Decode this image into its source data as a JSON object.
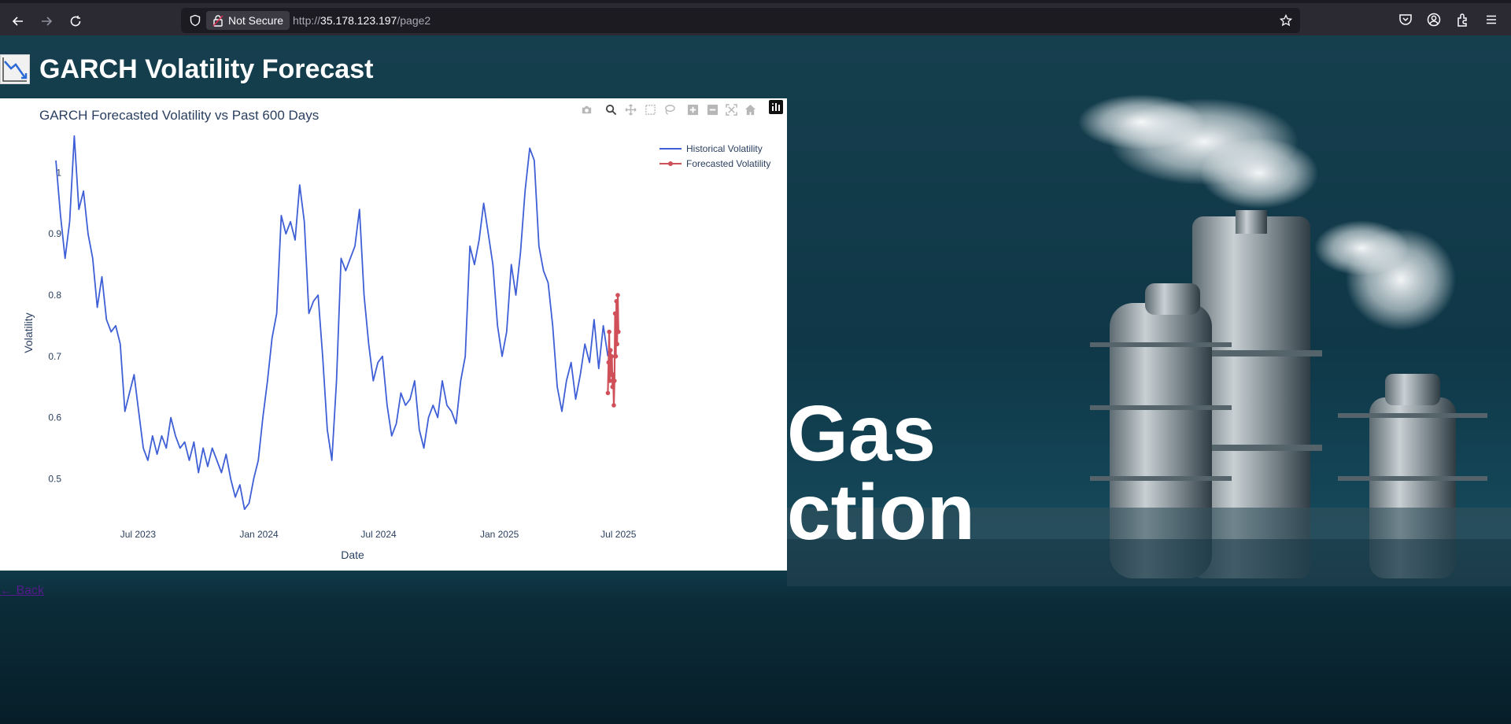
{
  "browser": {
    "security_label": "Not Secure",
    "url_prefix": "http://",
    "url_host": "35.178.123.197",
    "url_path": "/page2"
  },
  "page": {
    "title": "GARCH Volatility Forecast",
    "back_link": "← Back",
    "background_words": [
      "Gas",
      "ction"
    ]
  },
  "modebar": [
    "camera-icon",
    "zoom-icon",
    "pan-icon",
    "box-select-icon",
    "lasso-icon",
    "zoom-in-icon",
    "zoom-out-icon",
    "autoscale-icon",
    "reset-axes-icon",
    "plotly-logo"
  ],
  "colors": {
    "historical": "#3f5fd6",
    "forecast": "#d0505a",
    "text": "#2a3f5f"
  },
  "chart_data": {
    "type": "line",
    "title": "GARCH Forecasted Volatility vs Past 600 Days",
    "xlabel": "Date",
    "ylabel": "Volatility",
    "xlim": [
      "2023-02-20",
      "2025-07-18"
    ],
    "ylim": [
      0.44,
      1.07
    ],
    "x_ticks": [
      {
        "date": "2023-07-01",
        "label": "Jul 2023"
      },
      {
        "date": "2024-01-01",
        "label": "Jan 2024"
      },
      {
        "date": "2024-07-01",
        "label": "Jul 2024"
      },
      {
        "date": "2025-01-01",
        "label": "Jan 2025"
      },
      {
        "date": "2025-07-01",
        "label": "Jul 2025"
      }
    ],
    "y_ticks": [
      0.5,
      0.6,
      0.7,
      0.8,
      0.9,
      1
    ],
    "grid": false,
    "legend_position": "top-right",
    "series": [
      {
        "name": "Historical Volatility",
        "mode": "lines",
        "points": [
          [
            "2023-02-26",
            1.02
          ],
          [
            "2023-03-05",
            0.93
          ],
          [
            "2023-03-12",
            0.86
          ],
          [
            "2023-03-19",
            0.92
          ],
          [
            "2023-03-26",
            1.06
          ],
          [
            "2023-04-02",
            0.94
          ],
          [
            "2023-04-09",
            0.97
          ],
          [
            "2023-04-16",
            0.9
          ],
          [
            "2023-04-23",
            0.86
          ],
          [
            "2023-04-30",
            0.78
          ],
          [
            "2023-05-07",
            0.83
          ],
          [
            "2023-05-14",
            0.76
          ],
          [
            "2023-05-21",
            0.74
          ],
          [
            "2023-05-28",
            0.75
          ],
          [
            "2023-06-04",
            0.72
          ],
          [
            "2023-06-11",
            0.61
          ],
          [
            "2023-06-18",
            0.64
          ],
          [
            "2023-06-25",
            0.67
          ],
          [
            "2023-07-02",
            0.61
          ],
          [
            "2023-07-09",
            0.55
          ],
          [
            "2023-07-16",
            0.53
          ],
          [
            "2023-07-23",
            0.57
          ],
          [
            "2023-07-30",
            0.54
          ],
          [
            "2023-08-06",
            0.57
          ],
          [
            "2023-08-13",
            0.55
          ],
          [
            "2023-08-20",
            0.6
          ],
          [
            "2023-08-27",
            0.57
          ],
          [
            "2023-09-03",
            0.55
          ],
          [
            "2023-09-10",
            0.56
          ],
          [
            "2023-09-17",
            0.53
          ],
          [
            "2023-09-24",
            0.56
          ],
          [
            "2023-10-01",
            0.51
          ],
          [
            "2023-10-08",
            0.55
          ],
          [
            "2023-10-15",
            0.52
          ],
          [
            "2023-10-22",
            0.55
          ],
          [
            "2023-10-29",
            0.53
          ],
          [
            "2023-11-05",
            0.51
          ],
          [
            "2023-11-12",
            0.54
          ],
          [
            "2023-11-19",
            0.5
          ],
          [
            "2023-11-26",
            0.47
          ],
          [
            "2023-12-03",
            0.49
          ],
          [
            "2023-12-10",
            0.45
          ],
          [
            "2023-12-17",
            0.46
          ],
          [
            "2023-12-24",
            0.5
          ],
          [
            "2023-12-31",
            0.53
          ],
          [
            "2024-01-07",
            0.6
          ],
          [
            "2024-01-14",
            0.66
          ],
          [
            "2024-01-21",
            0.73
          ],
          [
            "2024-01-28",
            0.77
          ],
          [
            "2024-02-04",
            0.93
          ],
          [
            "2024-02-11",
            0.9
          ],
          [
            "2024-02-18",
            0.92
          ],
          [
            "2024-02-25",
            0.89
          ],
          [
            "2024-03-03",
            0.98
          ],
          [
            "2024-03-10",
            0.92
          ],
          [
            "2024-03-17",
            0.77
          ],
          [
            "2024-03-24",
            0.79
          ],
          [
            "2024-03-31",
            0.8
          ],
          [
            "2024-04-07",
            0.7
          ],
          [
            "2024-04-14",
            0.58
          ],
          [
            "2024-04-21",
            0.53
          ],
          [
            "2024-04-28",
            0.66
          ],
          [
            "2024-05-05",
            0.86
          ],
          [
            "2024-05-12",
            0.84
          ],
          [
            "2024-05-19",
            0.86
          ],
          [
            "2024-05-26",
            0.88
          ],
          [
            "2024-06-02",
            0.94
          ],
          [
            "2024-06-09",
            0.8
          ],
          [
            "2024-06-16",
            0.72
          ],
          [
            "2024-06-23",
            0.66
          ],
          [
            "2024-06-30",
            0.69
          ],
          [
            "2024-07-07",
            0.7
          ],
          [
            "2024-07-14",
            0.62
          ],
          [
            "2024-07-21",
            0.57
          ],
          [
            "2024-07-28",
            0.59
          ],
          [
            "2024-08-04",
            0.64
          ],
          [
            "2024-08-11",
            0.62
          ],
          [
            "2024-08-18",
            0.63
          ],
          [
            "2024-08-25",
            0.66
          ],
          [
            "2024-09-01",
            0.58
          ],
          [
            "2024-09-08",
            0.55
          ],
          [
            "2024-09-15",
            0.6
          ],
          [
            "2024-09-22",
            0.62
          ],
          [
            "2024-09-29",
            0.6
          ],
          [
            "2024-10-06",
            0.66
          ],
          [
            "2024-10-13",
            0.62
          ],
          [
            "2024-10-20",
            0.61
          ],
          [
            "2024-10-27",
            0.59
          ],
          [
            "2024-11-03",
            0.66
          ],
          [
            "2024-11-10",
            0.7
          ],
          [
            "2024-11-17",
            0.88
          ],
          [
            "2024-11-24",
            0.85
          ],
          [
            "2024-12-01",
            0.89
          ],
          [
            "2024-12-08",
            0.95
          ],
          [
            "2024-12-15",
            0.9
          ],
          [
            "2024-12-22",
            0.85
          ],
          [
            "2024-12-29",
            0.75
          ],
          [
            "2025-01-05",
            0.7
          ],
          [
            "2025-01-12",
            0.74
          ],
          [
            "2025-01-19",
            0.85
          ],
          [
            "2025-01-26",
            0.8
          ],
          [
            "2025-02-02",
            0.87
          ],
          [
            "2025-02-09",
            0.97
          ],
          [
            "2025-02-16",
            1.04
          ],
          [
            "2025-02-23",
            1.02
          ],
          [
            "2025-03-02",
            0.88
          ],
          [
            "2025-03-09",
            0.84
          ],
          [
            "2025-03-16",
            0.82
          ],
          [
            "2025-03-23",
            0.75
          ],
          [
            "2025-03-30",
            0.65
          ],
          [
            "2025-04-06",
            0.61
          ],
          [
            "2025-04-13",
            0.66
          ],
          [
            "2025-04-20",
            0.69
          ],
          [
            "2025-04-27",
            0.63
          ],
          [
            "2025-05-04",
            0.67
          ],
          [
            "2025-05-11",
            0.72
          ],
          [
            "2025-05-18",
            0.69
          ],
          [
            "2025-05-25",
            0.76
          ],
          [
            "2025-06-01",
            0.68
          ],
          [
            "2025-06-08",
            0.75
          ],
          [
            "2025-06-15",
            0.7
          ]
        ]
      },
      {
        "name": "Forecasted Volatility",
        "mode": "lines+markers",
        "points": [
          [
            "2025-06-15",
            0.64
          ],
          [
            "2025-06-16",
            0.69
          ],
          [
            "2025-06-17",
            0.74
          ],
          [
            "2025-06-18",
            0.66
          ],
          [
            "2025-06-19",
            0.71
          ],
          [
            "2025-06-20",
            0.67
          ],
          [
            "2025-06-21",
            0.7
          ],
          [
            "2025-06-22",
            0.65
          ],
          [
            "2025-06-23",
            0.67
          ],
          [
            "2025-06-24",
            0.62
          ],
          [
            "2025-06-25",
            0.66
          ],
          [
            "2025-06-26",
            0.77
          ],
          [
            "2025-06-27",
            0.7
          ],
          [
            "2025-06-28",
            0.79
          ],
          [
            "2025-06-29",
            0.72
          ],
          [
            "2025-06-30",
            0.8
          ],
          [
            "2025-07-01",
            0.74
          ]
        ]
      }
    ]
  }
}
